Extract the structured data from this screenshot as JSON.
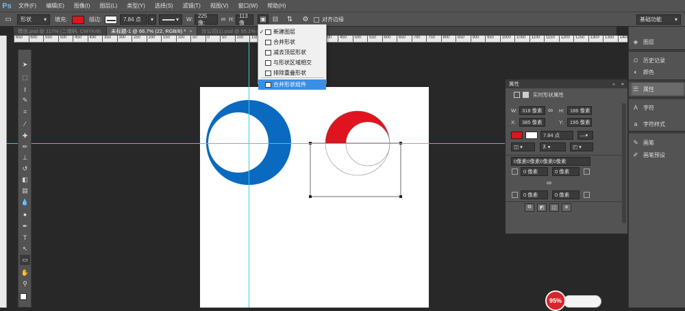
{
  "app": {
    "logo": "Ps"
  },
  "menubar": [
    "文件(F)",
    "编辑(E)",
    "图像(I)",
    "图层(L)",
    "类型(Y)",
    "选择(S)",
    "滤镜(T)",
    "视图(V)",
    "窗口(W)",
    "帮助(H)"
  ],
  "options": {
    "mode": "形状",
    "fill_label": "填充:",
    "stroke_label": "描边:",
    "stroke_width": "7.84 点",
    "w_label": "W:",
    "w_value": "225 像:",
    "h_label": "H:",
    "h_value": "113 像",
    "align_edges": "对齐边缘",
    "workspace": "基础功能",
    "fill_color": "#e0141e"
  },
  "tabs": [
    {
      "label": "微信.psd @ 117% (二维码, CMYK/8) *",
      "close": "×"
    },
    {
      "label": "未标题-1 @ 66.7% (22, RGB/8) *",
      "close": "×"
    },
    {
      "label": "分公司(1).psd @ 55.1% (图层 0, R",
      "close": ""
    }
  ],
  "ruler_labels": [
    "650",
    "600",
    "550",
    "500",
    "450",
    "400",
    "350",
    "300",
    "250",
    "200",
    "150",
    "100",
    "50",
    "0",
    "50",
    "100",
    "150",
    "200",
    "250",
    "300",
    "350",
    "400",
    "450",
    "500",
    "550",
    "600",
    "650",
    "700",
    "750",
    "800",
    "850",
    "900",
    "950",
    "1000",
    "1050",
    "1100",
    "1150",
    "1200",
    "1250",
    "1300",
    "1350",
    "1400"
  ],
  "dropdown": {
    "items": [
      {
        "label": "新建图层",
        "checked": true,
        "highlight": false
      },
      {
        "label": "合并形状",
        "checked": false,
        "highlight": false
      },
      {
        "label": "减去顶层形状",
        "checked": false,
        "highlight": false
      },
      {
        "label": "与形状区域相交",
        "checked": false,
        "highlight": false
      },
      {
        "label": "排除重叠形状",
        "checked": false,
        "highlight": false
      },
      {
        "label": "合并形状组件",
        "checked": false,
        "highlight": true
      }
    ]
  },
  "dock": {
    "items": [
      {
        "label": "图层",
        "icon": "layers-icon",
        "selected": false
      },
      {
        "label": "历史记录",
        "icon": "history-icon",
        "selected": false
      },
      {
        "label": "颜色",
        "icon": "color-icon",
        "selected": false
      },
      {
        "label": "属性",
        "icon": "properties-icon",
        "selected": true
      },
      {
        "label": "字符",
        "icon": "character-icon",
        "selected": false
      },
      {
        "label": "字符样式",
        "icon": "character-style-icon",
        "selected": false
      },
      {
        "label": "画笔",
        "icon": "brush-icon",
        "selected": false
      },
      {
        "label": "画笔预设",
        "icon": "brush-preset-icon",
        "selected": false
      }
    ]
  },
  "properties": {
    "title": "属性",
    "subtitle": "实时形状属性",
    "w_label": "W:",
    "w": "318 像素",
    "h_label": "H:",
    "h": "186 像素",
    "x_label": "X:",
    "x": "385 像素",
    "y_label": "Y:",
    "y": "195 像素",
    "stroke": "7.84 点",
    "corner_all": "0像素0像素0像素0像素",
    "c1": "0 像素",
    "c2": "0 像素",
    "c3": "0 像素",
    "c4": "0 像素",
    "zero": "0",
    "swatch_color": "#e0141e"
  },
  "zoom": {
    "value": "95%"
  },
  "colors": {
    "blue": "#0a6abf",
    "red": "#e0141e",
    "guide": "#3ec8e0"
  }
}
